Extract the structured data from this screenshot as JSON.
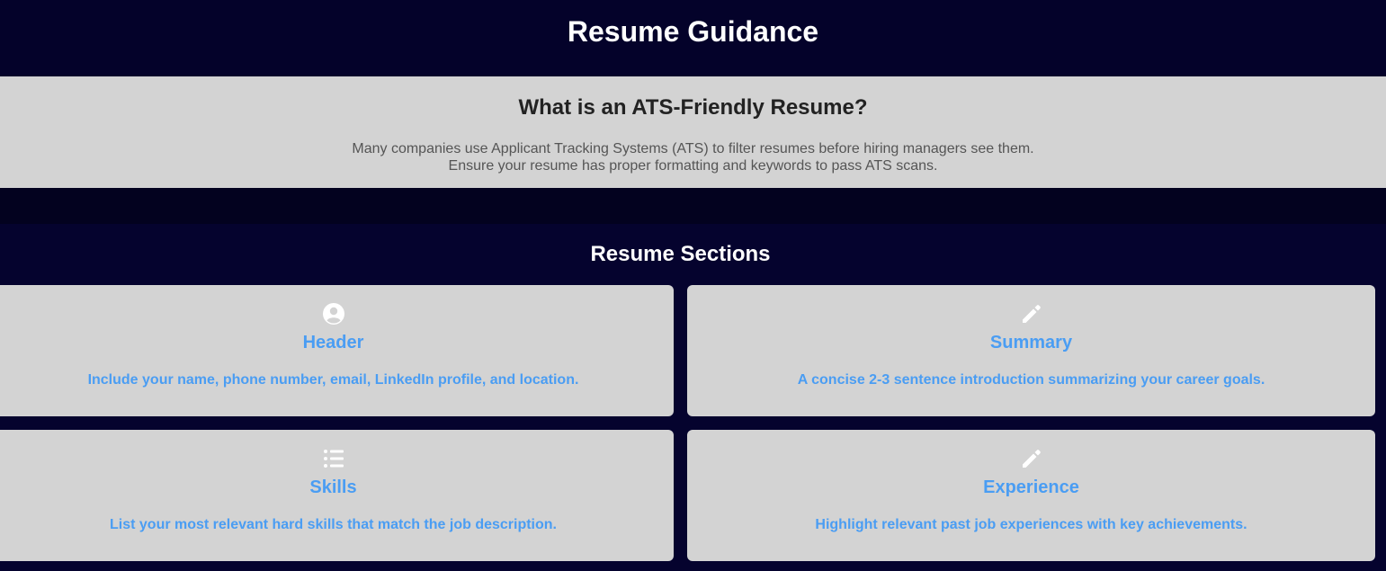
{
  "header": {
    "title": "Resume Guidance"
  },
  "ats": {
    "heading": "What is an ATS-Friendly Resume?",
    "line1": "Many companies use Applicant Tracking Systems (ATS) to filter resumes before hiring managers see them.",
    "line2": "Ensure your resume has proper formatting and keywords to pass ATS scans."
  },
  "sections": {
    "title": "Resume Sections",
    "cards": [
      {
        "icon": "user-circle-icon",
        "title": "Header",
        "text": "Include your name, phone number, email, LinkedIn profile, and location."
      },
      {
        "icon": "pencil-icon",
        "title": "Summary",
        "text": "A concise 2-3 sentence introduction summarizing your career goals."
      },
      {
        "icon": "list-icon",
        "title": "Skills",
        "text": "List your most relevant hard skills that match the job description."
      },
      {
        "icon": "pencil-icon",
        "title": "Experience",
        "text": "Highlight relevant past job experiences with key achievements."
      }
    ]
  },
  "colors": {
    "background": "#05032e",
    "card": "#d3d3d3",
    "accent": "#4a9df3"
  }
}
